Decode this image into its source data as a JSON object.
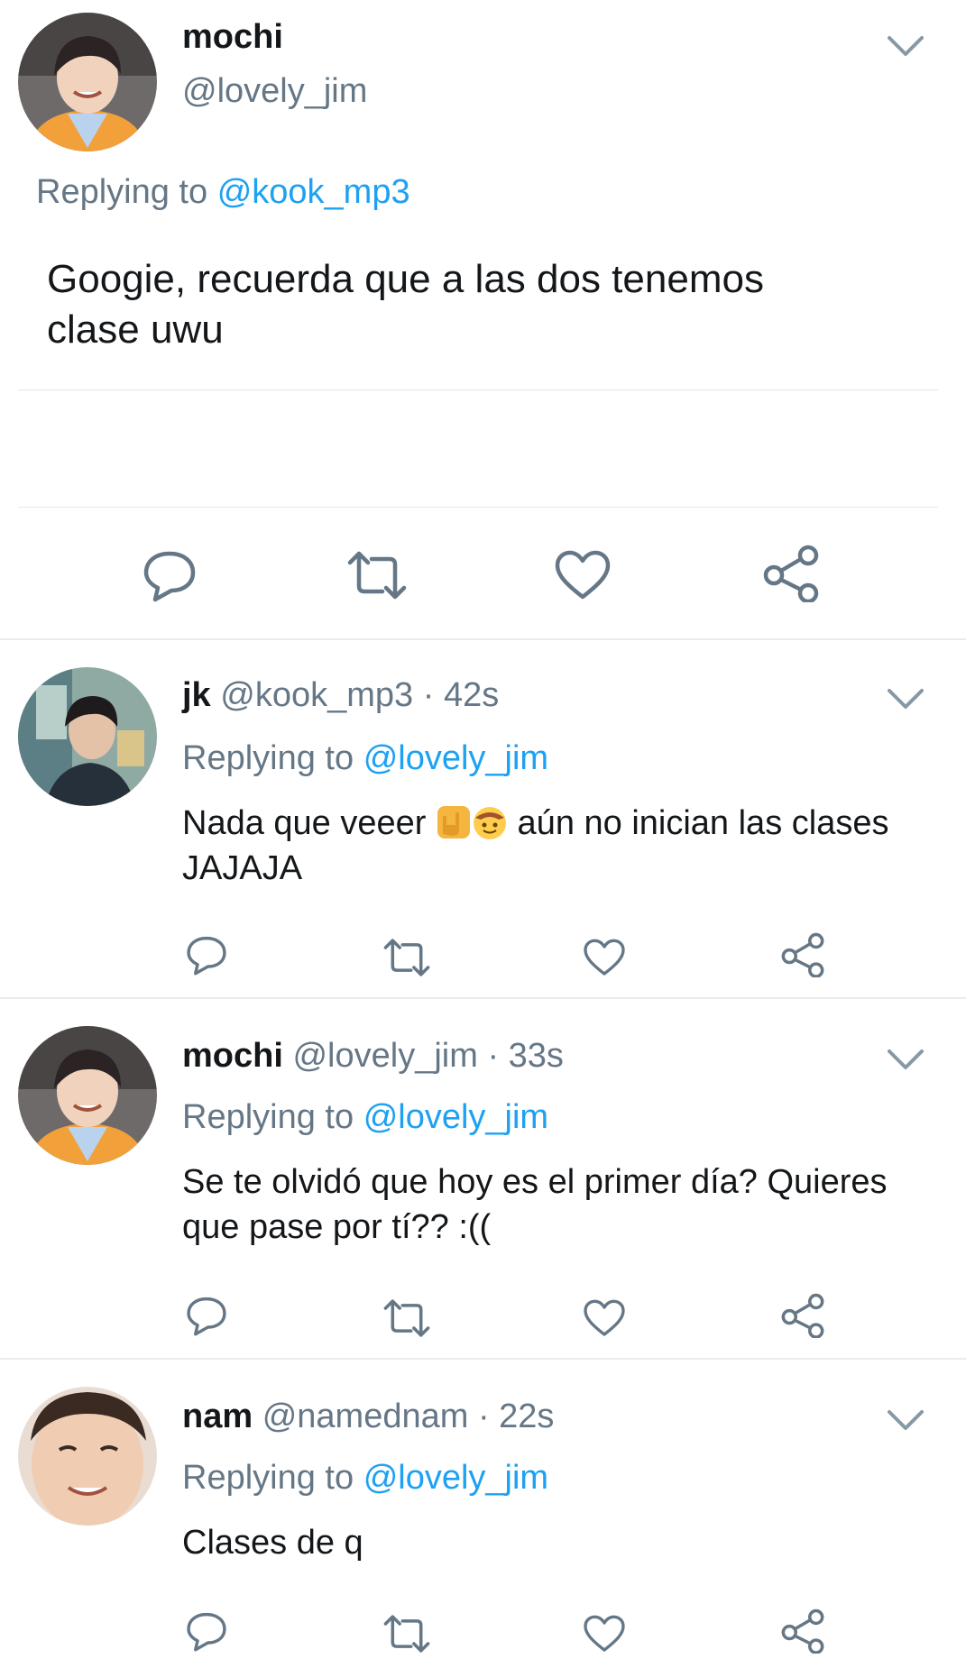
{
  "main_tweet": {
    "display_name": "mochi",
    "handle": "@lovely_jim",
    "replying_prefix": "Replying to",
    "replying_to": "@kook_mp3",
    "text": "Googie, recuerda que a las dos tenemos clase uwu"
  },
  "replies": [
    {
      "display_name": "jk",
      "handle": "@kook_mp3",
      "time": "· 42s",
      "replying_prefix": "Replying to",
      "replying_to": "@lovely_jim",
      "text_before_emoji": "Nada que veeer",
      "emojis": [
        "sign-of-horns-emoji",
        "cowboy-face-emoji"
      ],
      "text_after_emoji": "aún no inician las clases JAJAJA"
    },
    {
      "display_name": "mochi",
      "handle": "@lovely_jim",
      "time": "· 33s",
      "replying_prefix": "Replying to",
      "replying_to": "@lovely_jim",
      "text": "Se te olvidó que hoy es el primer día? Quieres que pase por tí?? :(("
    },
    {
      "display_name": "nam",
      "handle": "@namednam",
      "time": "· 22s",
      "replying_prefix": "Replying to",
      "replying_to": "@lovely_jim",
      "text": "Clases de q"
    }
  ],
  "icons": [
    "reply-icon",
    "retweet-icon",
    "like-icon",
    "share-icon",
    "chevron-down-icon"
  ],
  "colors": {
    "link": "#1da1f2",
    "muted": "#657786",
    "divider": "#e6ecf0"
  }
}
